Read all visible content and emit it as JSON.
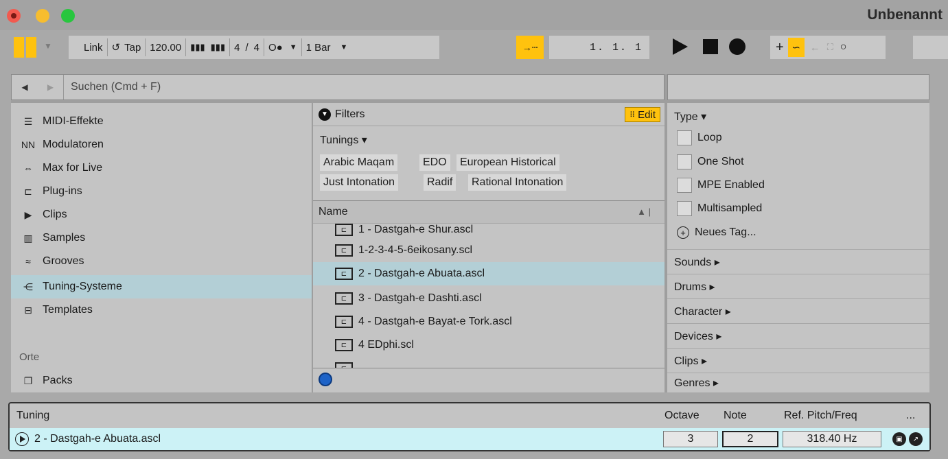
{
  "window": {
    "title": "Unbenannt"
  },
  "controlbar": {
    "link": "Link",
    "tap": "Tap",
    "tempo": "120.00",
    "signature_num": "4",
    "signature_slash": "/",
    "signature_den": "4",
    "metronome": "O●",
    "quantize": "1 Bar",
    "position": "1.  1.  1"
  },
  "search": {
    "placeholder": "Suchen (Cmd + F)"
  },
  "sidebar": {
    "items": [
      {
        "label": "MIDI-Effekte",
        "icon": "midi-effects-icon"
      },
      {
        "label": "Modulatoren",
        "icon": "modulators-icon"
      },
      {
        "label": "Max for Live",
        "icon": "max-for-live-icon"
      },
      {
        "label": "Plug-ins",
        "icon": "plugins-icon"
      },
      {
        "label": "Clips",
        "icon": "clips-icon"
      },
      {
        "label": "Samples",
        "icon": "samples-icon"
      },
      {
        "label": "Grooves",
        "icon": "grooves-icon"
      },
      {
        "label": "Tuning-Systeme",
        "icon": "tuning-systems-icon",
        "selected": true
      },
      {
        "label": "Templates",
        "icon": "templates-icon"
      }
    ],
    "places_heading": "Orte",
    "packs": "Packs"
  },
  "filters": {
    "title": "Filters",
    "edit": "Edit",
    "tunings_heading": "Tunings ▾",
    "tags": [
      "Arabic Maqam",
      "EDO",
      "European Historical",
      "Just Intonation",
      "Radif",
      "Rational Intonation"
    ]
  },
  "list": {
    "header": "Name",
    "rows": [
      "1 - Dastgah-e Shur.ascl",
      "1-2-3-4-5-6eikosany.scl",
      "2 - Dastgah-e Abuata.ascl",
      "3 - Dastgah-e Dashti.ascl",
      "4 - Dastgah-e Bayat-e Tork.ascl",
      "4 EDphi.scl"
    ],
    "selected_index": 2
  },
  "tags_panel": {
    "type_heading": "Type ▾",
    "checkboxes": [
      "Loop",
      "One Shot",
      "MPE Enabled",
      "Multisampled"
    ],
    "new_tag": "Neues Tag...",
    "categories": [
      "Sounds ▸",
      "Drums ▸",
      "Character ▸",
      "Devices ▸",
      "Clips ▸",
      "Genres ▸"
    ]
  },
  "tuning_panel": {
    "title": "Tuning",
    "col_octave": "Octave",
    "col_note": "Note",
    "col_ref": "Ref. Pitch/Freq",
    "more": "...",
    "name": "2 - Dastgah-e Abuata.ascl",
    "octave": "3",
    "note": "2",
    "ref": "318.40 Hz"
  },
  "colors": {
    "accent": "#ffc20e",
    "selection": "#b3cfd6",
    "panel_row": "#ccf2f6"
  }
}
